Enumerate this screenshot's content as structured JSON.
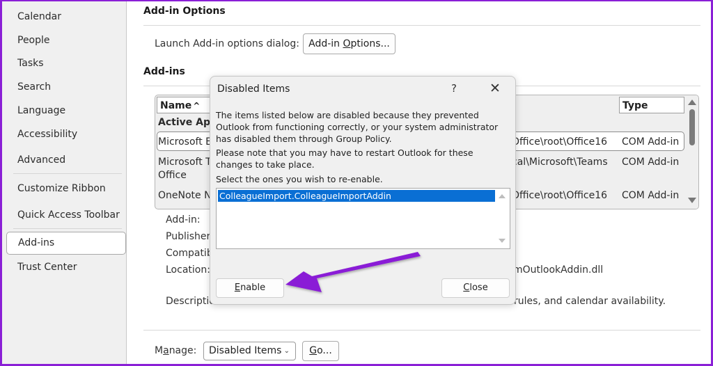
{
  "sidebar": {
    "items": [
      {
        "label": "Calendar"
      },
      {
        "label": "People"
      },
      {
        "label": "Tasks"
      },
      {
        "label": "Search"
      },
      {
        "label": "Language"
      },
      {
        "label": "Accessibility"
      },
      {
        "label": "Advanced"
      },
      {
        "label": "Customize Ribbon"
      },
      {
        "label": "Quick Access Toolbar"
      },
      {
        "label": "Add-ins",
        "active": true
      },
      {
        "label": "Trust Center"
      }
    ]
  },
  "main": {
    "addin_options": {
      "title": "Add-in Options",
      "launch_label": "Launch Add-in options dialog:",
      "button_pre": "Add-in ",
      "button_accel": "O",
      "button_post": "ptions..."
    },
    "addins": {
      "title": "Add-ins",
      "columns": {
        "name": "Name",
        "name_sort": "^",
        "type": "Type"
      },
      "group_header": "Active App",
      "rows": [
        {
          "name": "Microsoft E",
          "location": "Office\\root\\Office16",
          "type": "COM Add-in",
          "selected": true
        },
        {
          "name": "Microsoft T",
          "name_line2": "Office",
          "location": "cal\\Microsoft\\Teams",
          "type": "COM Add-in"
        },
        {
          "name": "OneNote N",
          "location": "Office\\root\\Office16",
          "type": "COM Add-in"
        }
      ]
    },
    "details": {
      "addin_label": "Add-in:",
      "publisher_label": "Publisher:",
      "compat_label": "Compatib",
      "location_label": "Location:",
      "location_value": "mOutlookAddin.dll",
      "description_label": "Descriptio",
      "description_value": "rules, and calendar availability."
    },
    "manage": {
      "label_pre": "M",
      "label_accel": "a",
      "label_post": "nage:",
      "selected": "Disabled Items",
      "go_accel": "G",
      "go_post": "o..."
    }
  },
  "dialog": {
    "title": "Disabled Items",
    "help": "?",
    "close": "✕",
    "text1": "The items listed below are disabled because they prevented Outlook from functioning correctly, or your system administrator has disabled them through Group Policy.",
    "text2": "Please note that you may have to restart Outlook for these changes to take place.",
    "text3": "Select the ones you wish to re-enable.",
    "items": [
      "ColleagueImport.ColleagueImportAddin"
    ],
    "enable_accel": "E",
    "enable_post": "nable",
    "close_accel": "C",
    "close_post": "lose"
  },
  "annotation": {
    "color": "#8a1fd6",
    "type": "arrow",
    "target": "enable-button"
  }
}
